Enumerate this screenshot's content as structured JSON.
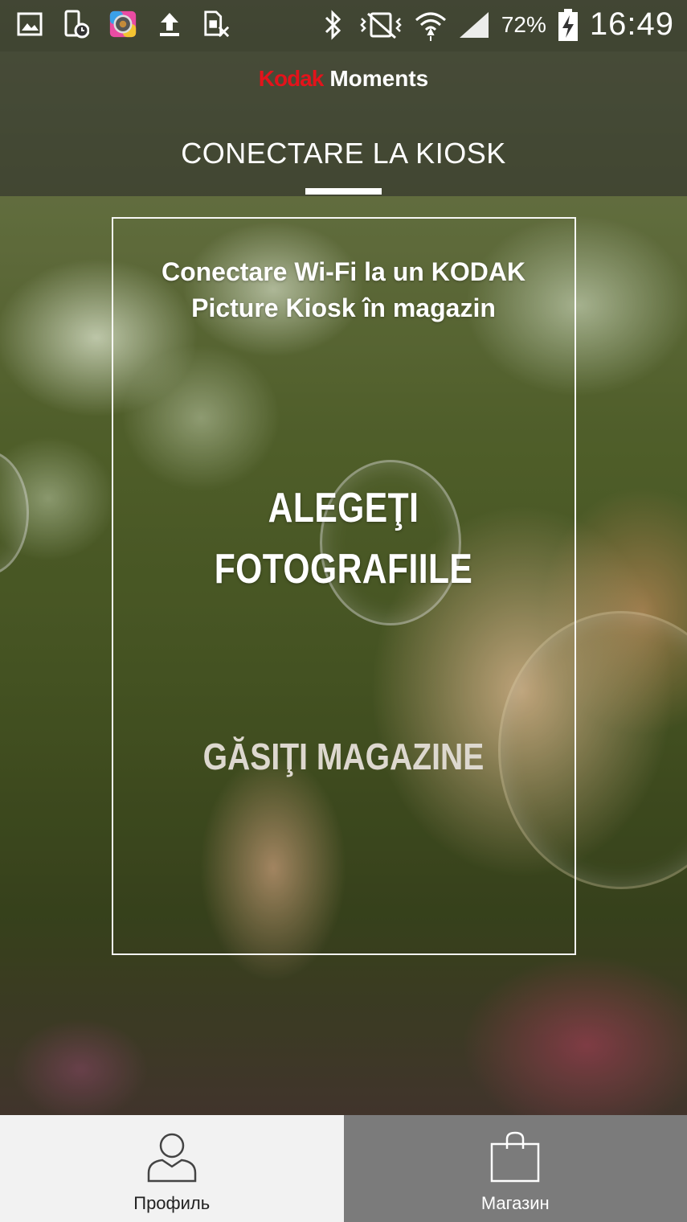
{
  "status_bar": {
    "battery": "72%",
    "time": "16:49",
    "left_icons": [
      "gallery-icon",
      "phone-clock-icon",
      "camera-app-icon",
      "upload-icon",
      "sim-off-icon"
    ],
    "right_icons": [
      "bluetooth-icon",
      "vibrate-icon",
      "wifi-icon",
      "signal-icon",
      "battery-charging-icon"
    ]
  },
  "header": {
    "logo_brand": "Kodak",
    "logo_sub": "Moments",
    "tab_title": "CONECTARE LA KIOSK"
  },
  "main": {
    "subtitle": "Conectare Wi-Fi la un KODAK Picture Kiosk în magazin",
    "choose_photos": "ALEGEŢI FOTOGRAFIILE",
    "find_stores": "GĂSIŢI MAGAZINE"
  },
  "bottom_nav": {
    "profile_label": "Профиль",
    "store_label": "Магазин",
    "profile_icon": "user-icon",
    "store_icon": "shopping-bag-icon"
  },
  "colors": {
    "brand_red": "#e3131b",
    "nav_active_bg": "#f2f2f2",
    "nav_inactive_bg": "#7b7b7b"
  }
}
